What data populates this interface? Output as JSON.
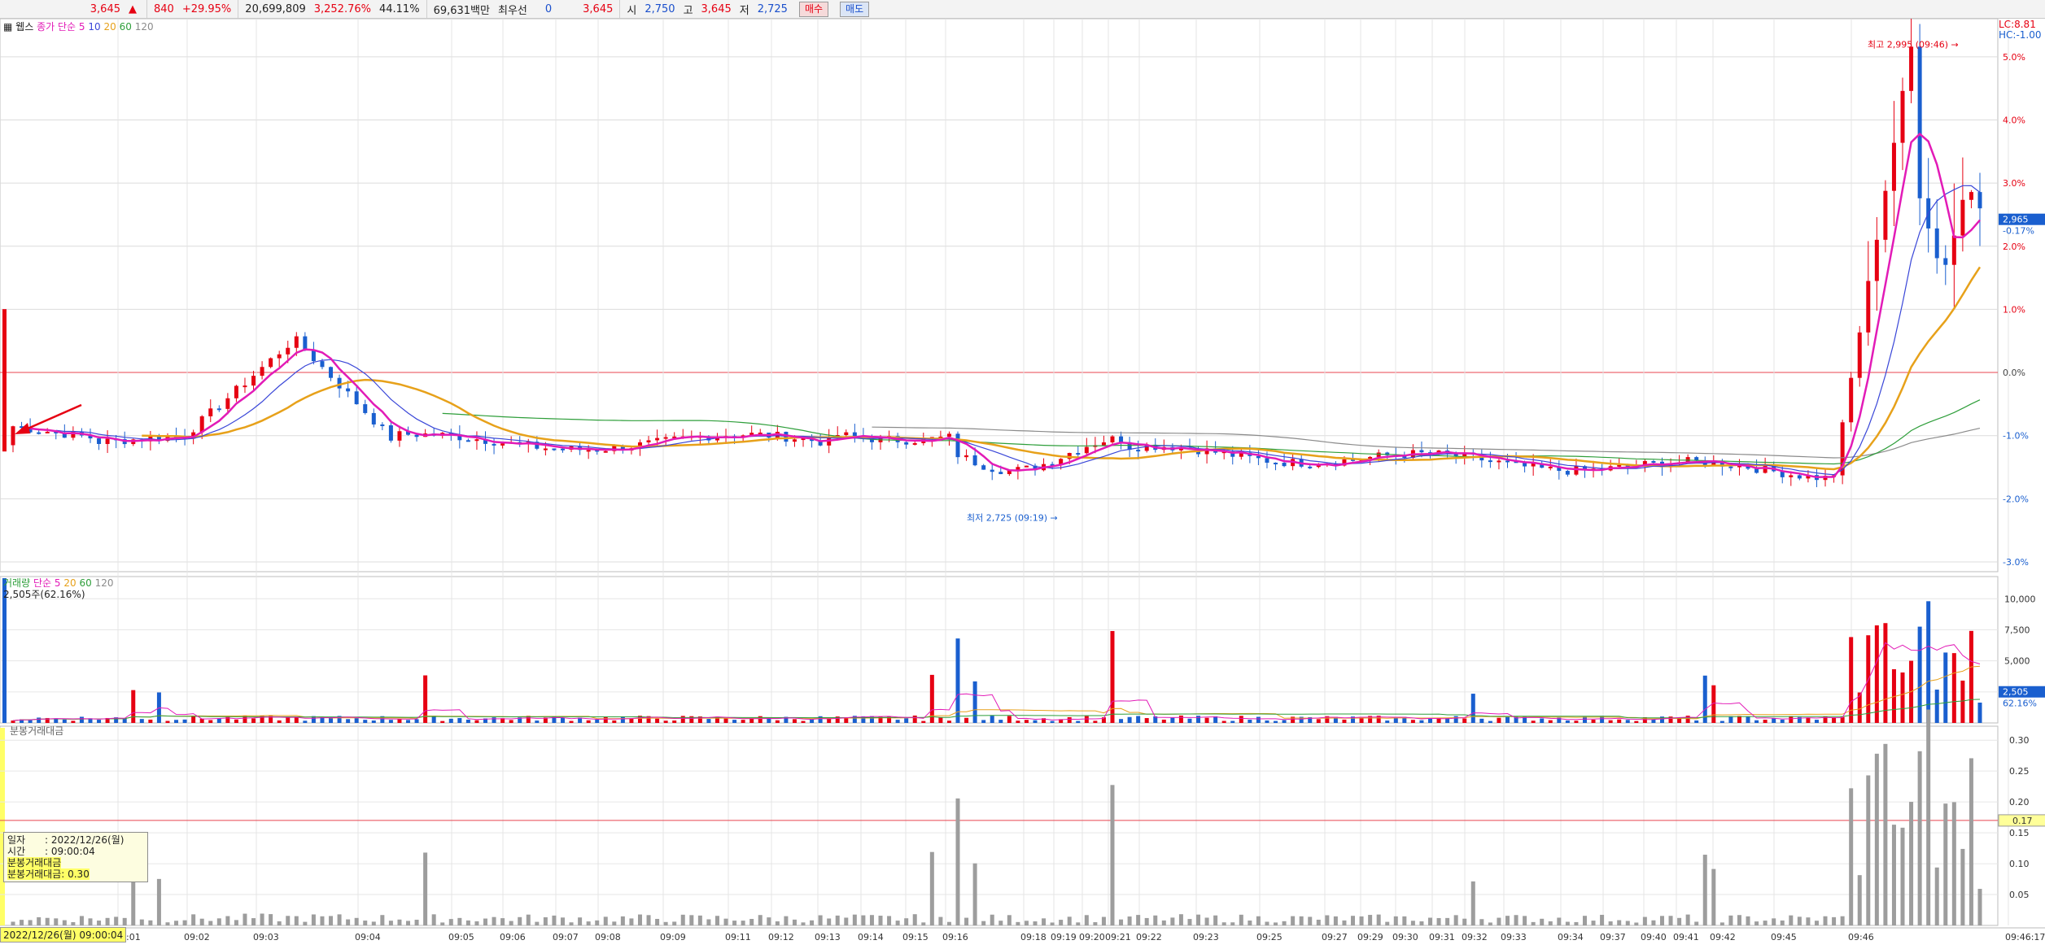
{
  "topbar": {
    "price": "3,645",
    "change": "840",
    "change_pct": "+29.95%",
    "volume": "20,699,809",
    "volume_ratio": "3,252.76%",
    "turnover": "44.11%",
    "amount": "69,631백만",
    "best_label": "최우선",
    "best_bid": "0",
    "best_ask": "3,645",
    "open_label": "시",
    "open": "2,750",
    "high_label": "고",
    "high": "3,645",
    "low_label": "저",
    "low": "2,725",
    "buy_label": "매수",
    "sell_label": "매도"
  },
  "legends": {
    "price_title": "웹스",
    "price_ma": "종가 단순",
    "ma_periods": [
      "5",
      "10",
      "20",
      "60",
      "120"
    ],
    "volume_title": "거래량",
    "volume_ma": "단순",
    "volume_periods": [
      "5",
      "20",
      "60",
      "120"
    ],
    "volume_current": "2,505주(62.16%)",
    "amount_title": "분봉거래대금",
    "lc": "LC:8.81",
    "hc": "HC:-1.00"
  },
  "tooltip": {
    "date_label": "일자",
    "date": ": 2022/12/26(월)",
    "time_label": "시간",
    "time": ": 09:00:04",
    "item1": "분봉거래대금",
    "item2_label": "분봉거래대금",
    "item2_value": ": 0.30"
  },
  "date_box": "2022/12/26(월) 09:00:04",
  "colors": {
    "up": "#e60012",
    "down": "#1a5fcf",
    "ma5": "#e21bb7",
    "ma10": "#3a47d8",
    "ma20": "#e7a11a",
    "ma60": "#2e9e3a",
    "ma120": "#8b8b8b",
    "amount": "#9d9d9d"
  },
  "chart_data": [
    {
      "type": "candlestick",
      "title": "",
      "annotations": [
        {
          "text": "최고 2,995 (09:46)",
          "x": "09:46",
          "y": 5.2
        },
        {
          "text": "최저 2,725 (09:19)",
          "x": "09:19",
          "y": -2.3
        }
      ],
      "y_unit": "%",
      "y_ticks": [
        "5.0%",
        "4.0%",
        "3.0%",
        "2.0%",
        "1.0%",
        "0.0%",
        "-1.0%",
        "-2.0%",
        "-3.0%"
      ],
      "ylim": [
        -3.0,
        5.5
      ],
      "current_value": "2,965",
      "current_pct": "-0.17%",
      "x_ticks": [
        "09:01",
        "09:02",
        "09:03",
        "09:04",
        "09:05",
        "09:06",
        "09:07",
        "09:08",
        "09:09",
        "09:11",
        "09:12",
        "09:13",
        "09:14",
        "09:15",
        "09:16",
        "09:18",
        "09:19",
        "09:20",
        "09:21",
        "09:22",
        "09:23",
        "09:25",
        "09:27",
        "09:29",
        "09:30",
        "09:31",
        "09:32",
        "09:33",
        "09:34",
        "09:37",
        "09:40",
        "09:41",
        "09:42",
        "09:45",
        "09:46",
        "09:46:17"
      ]
    },
    {
      "type": "bar",
      "title": "",
      "y_ticks": [
        "10,000",
        "7,500",
        "5,000",
        "2,500"
      ],
      "ylim": [
        0,
        11000
      ],
      "current_value": "2,505",
      "current_pct": "62.16%"
    },
    {
      "type": "bar",
      "title": "",
      "y_ticks": [
        "0.30",
        "0.25",
        "0.20",
        "0.15",
        "0.10",
        "0.05"
      ],
      "ylim": [
        0,
        0.32
      ],
      "reference": "0.17"
    }
  ]
}
